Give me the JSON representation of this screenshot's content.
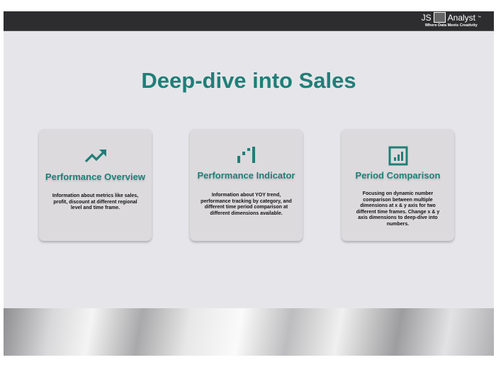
{
  "header": {
    "logo_text": "JS Analyst",
    "logo_mark": "™",
    "tagline": "Where Data Meets Creativity"
  },
  "main": {
    "title": "Deep-dive into Sales",
    "cards": [
      {
        "icon": "trending-up-icon",
        "title": "Performance Overview",
        "description": "Information about metrics like sales, profit, discount at different regional level and time frame."
      },
      {
        "icon": "bar-steps-icon",
        "title": "Performance Indicator",
        "description": "Information about YOY trend, performance tracking by category, and different time period comparison at different dimensions available."
      },
      {
        "icon": "bar-chart-box-icon",
        "title": "Period Comparison",
        "description": "Focusing on dynamic number comparison between multiple dimensions at x & y axis for two different time frames. Change x & y axis dimensions to deep-dive into numbers."
      }
    ]
  },
  "colors": {
    "accent": "#1f7f78",
    "header_bg": "#2d2d30",
    "page_bg": "#e6e6ea"
  }
}
